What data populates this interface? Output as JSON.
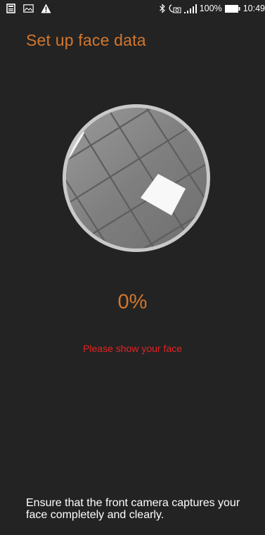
{
  "status_bar": {
    "left_icons": [
      "news-icon",
      "image-icon",
      "warning-icon"
    ],
    "right_icons": [
      "bluetooth-icon",
      "volte-icon",
      "signal-icon"
    ],
    "battery_percent": "100%",
    "battery_icon": "battery-full-icon",
    "time": "10:49"
  },
  "header": {
    "title": "Set up face data"
  },
  "camera_preview": {
    "ring_color": "#c9c9c9"
  },
  "progress": {
    "percent_label": "0%",
    "value": 0,
    "hint": "Please show your face"
  },
  "footer": {
    "instructions": "Ensure that the front camera captures your face completely and clearly."
  },
  "colors": {
    "background": "#232323",
    "accent": "#d2772e",
    "error": "#e62222"
  }
}
